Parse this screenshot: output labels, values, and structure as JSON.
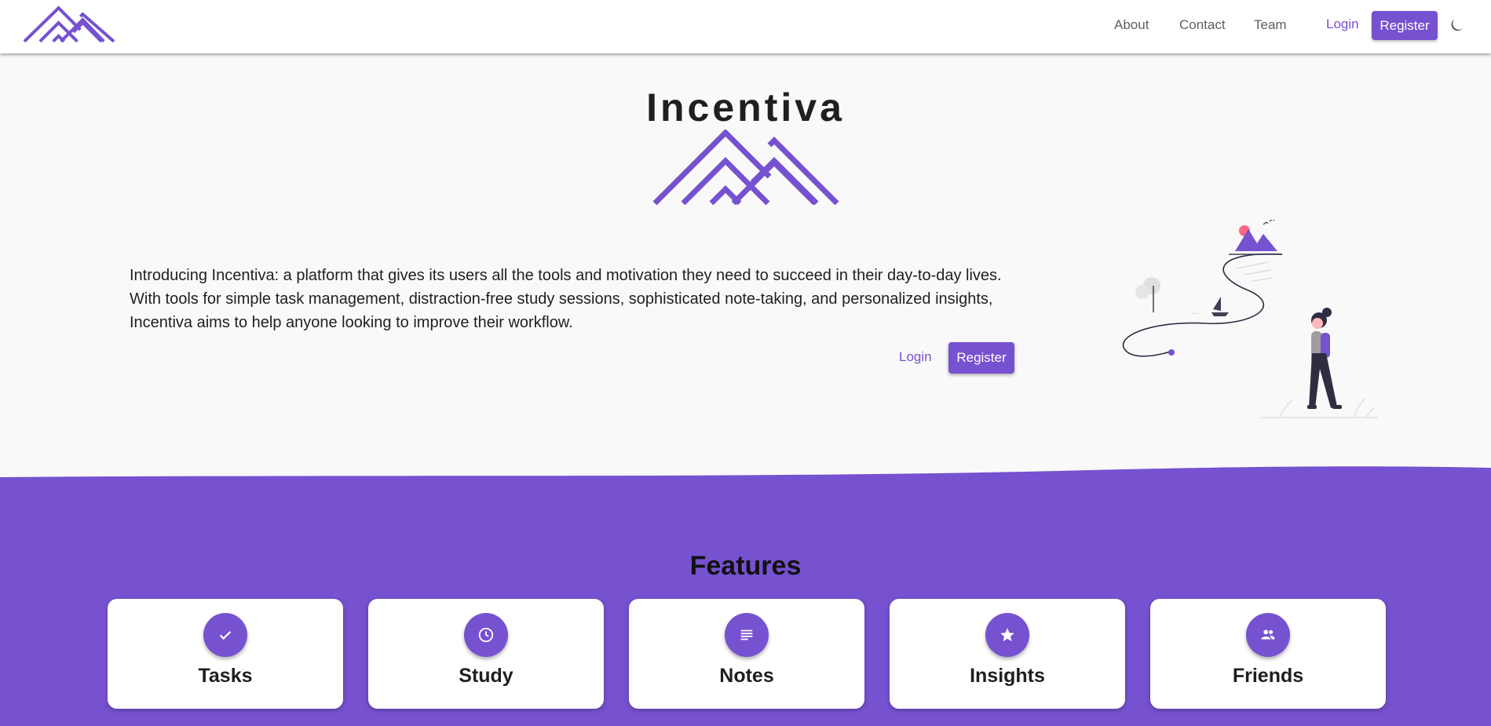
{
  "brand": {
    "name": "Incentiva",
    "accent": "#7651d0"
  },
  "nav": {
    "links": [
      "About",
      "Contact",
      "Team"
    ],
    "login_label": "Login",
    "register_label": "Register",
    "theme_icon": "moon-icon"
  },
  "hero": {
    "title": "Incentiva",
    "intro_lines": [
      "Introducing Incentiva: a platform that gives its users all the tools and motivation they need to succeed in their day-to-day lives.",
      "With tools for simple task management, distraction-free study sessions, sophisticated note-taking, and personalized insights,",
      "Incentiva aims to help anyone looking to improve their workflow."
    ],
    "login_label": "Login",
    "register_label": "Register"
  },
  "features": {
    "title": "Features",
    "items": [
      {
        "label": "Tasks",
        "icon": "check-icon"
      },
      {
        "label": "Study",
        "icon": "clock-icon"
      },
      {
        "label": "Notes",
        "icon": "notes-icon"
      },
      {
        "label": "Insights",
        "icon": "star-icon"
      },
      {
        "label": "Friends",
        "icon": "people-icon"
      }
    ]
  }
}
